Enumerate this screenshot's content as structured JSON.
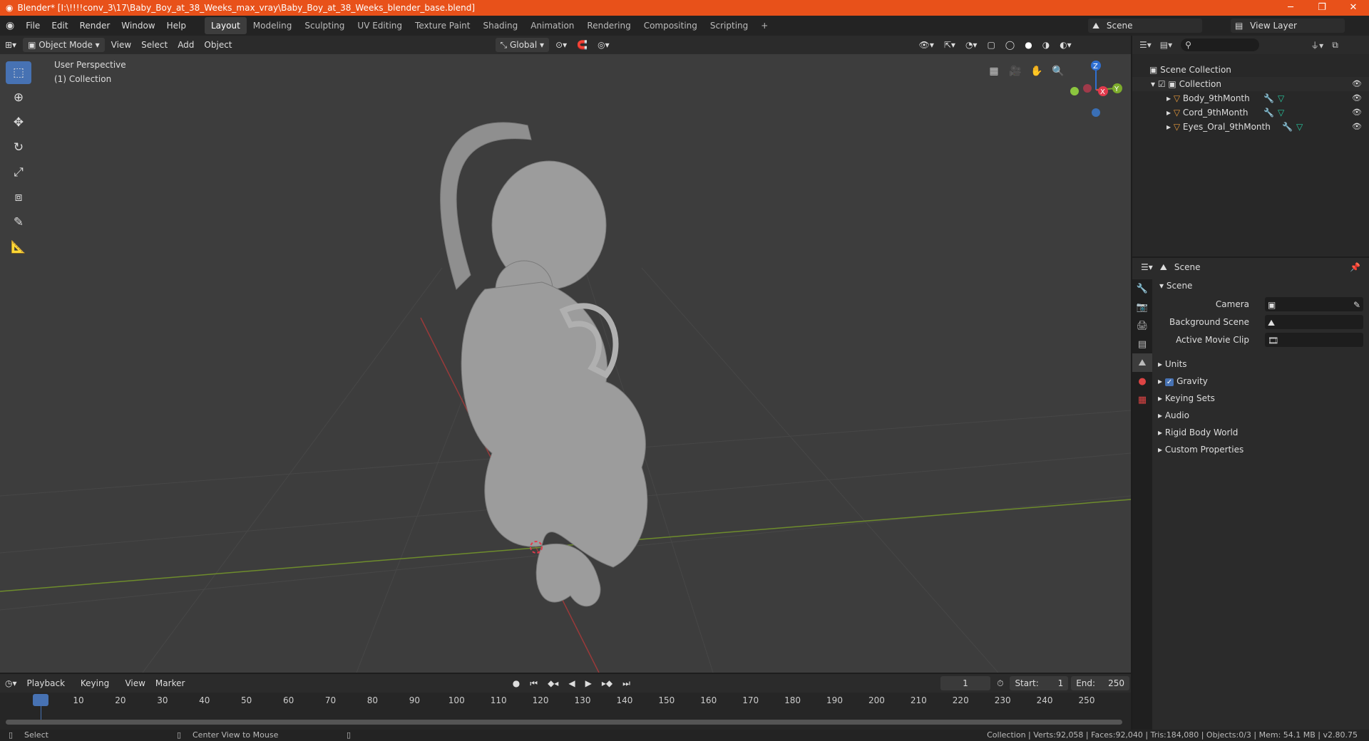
{
  "window": {
    "title": "Blender* [I:\\!!!!conv_3\\17\\Baby_Boy_at_38_Weeks_max_vray\\Baby_Boy_at_38_Weeks_blender_base.blend]",
    "minimize": "─",
    "restore": "❐",
    "close": "✕"
  },
  "menu": [
    "File",
    "Edit",
    "Render",
    "Window",
    "Help"
  ],
  "workspaces": [
    "Layout",
    "Modeling",
    "Sculpting",
    "UV Editing",
    "Texture Paint",
    "Shading",
    "Animation",
    "Rendering",
    "Compositing",
    "Scripting"
  ],
  "workspace_add": "+",
  "scene_name": "Scene",
  "view_layer": "View Layer",
  "viewport_header": {
    "mode": "Object Mode",
    "view": "View",
    "select": "Select",
    "add": "Add",
    "object": "Object",
    "orientation": "Global"
  },
  "viewport": {
    "perspective": "User Perspective",
    "collection": "(1) Collection"
  },
  "gizmo": {
    "z": "Z",
    "x": "X",
    "y": "Y"
  },
  "outliner": {
    "root": "Scene Collection",
    "collection": "Collection",
    "objects": [
      "Body_9thMonth",
      "Cord_9thMonth",
      "Eyes_Oral_9thMonth"
    ]
  },
  "properties": {
    "context": "Scene",
    "panel": "Scene",
    "camera_label": "Camera",
    "background_label": "Background Scene",
    "movieclip_label": "Active Movie Clip",
    "sections": [
      "Units",
      "Gravity",
      "Keying Sets",
      "Audio",
      "Rigid Body World",
      "Custom Properties"
    ]
  },
  "timeline": {
    "playback": "Playback",
    "keying": "Keying",
    "view": "View",
    "marker": "Marker",
    "current": "1",
    "start_label": "Start:",
    "start": "1",
    "end_label": "End:",
    "end": "250",
    "ticks": [
      "1",
      "10",
      "20",
      "30",
      "40",
      "50",
      "60",
      "70",
      "80",
      "90",
      "100",
      "110",
      "120",
      "130",
      "140",
      "150",
      "160",
      "170",
      "180",
      "190",
      "200",
      "210",
      "220",
      "230",
      "240",
      "250"
    ]
  },
  "status": {
    "select": "Select",
    "center": "Center View to Mouse",
    "stats": "Collection | Verts:92,058 | Faces:92,040 | Tris:184,080 | Objects:0/3 | Mem: 54.1 MB | v2.80.75"
  },
  "colors": {
    "title_bar": "#e8511a",
    "accent": "#4772b3",
    "axis_x": "#e23a4d",
    "axis_y": "#7dac2c",
    "axis_z": "#2f6fd1"
  }
}
